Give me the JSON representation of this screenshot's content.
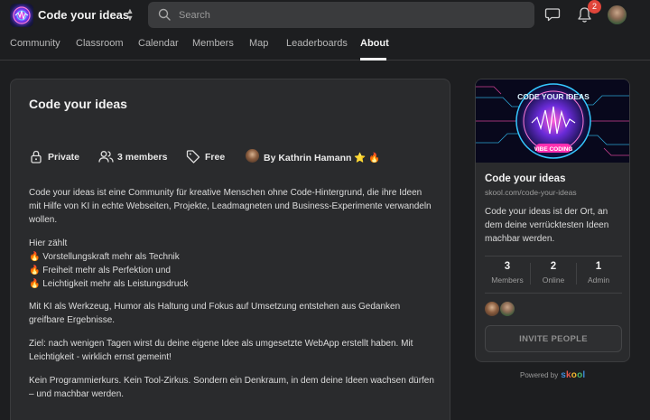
{
  "header": {
    "brand_name": "Code your ideas",
    "search_placeholder": "Search",
    "notification_count": "2"
  },
  "nav": {
    "tabs": [
      "Community",
      "Classroom",
      "Calendar",
      "Members",
      "Map",
      "Leaderboards",
      "About"
    ],
    "active_tab": "About"
  },
  "about": {
    "title": "Code your ideas",
    "meta": {
      "privacy": "Private",
      "members": "3 members",
      "price": "Free",
      "owner": "By Kathrin Hamann ⭐ 🔥"
    },
    "paragraphs": [
      "Code your ideas ist eine Community für kreative Menschen ohne Code-Hintergrund, die ihre Ideen mit Hilfe von KI in echte Webseiten, Projekte, Leadmagneten und Business-Experimente verwandeln wollen.",
      "Hier zählt",
      "🔥 Vorstellungskraft mehr als Technik",
      "🔥 Freiheit mehr als Perfektion und",
      "🔥 Leichtigkeit mehr als Leistungsdruck",
      "Mit KI als Werkzeug, Humor als Haltung und Fokus auf Umsetzung entstehen aus Gedanken greifbare Ergebnisse.",
      "Ziel: nach wenigen Tagen wirst du deine eigene Idee als umgesetzte WebApp erstellt haben. Mit Leichtigkeit - wirklich ernst gemeint!",
      "Kein Programmierkurs. Kein Tool-Zirkus. Sondern ein Denkraum, in dem deine Ideen wachsen dürfen – und machbar werden."
    ]
  },
  "sidebar": {
    "cover_text_top": "CODE YOUR IDEAS",
    "cover_text_bottom": "VIBE CODING",
    "name": "Code your ideas",
    "url": "skool.com/code-your-ideas",
    "description": "Code your ideas ist der Ort, an dem deine verrücktesten Ideen machbar werden.",
    "stats": [
      {
        "value": "3",
        "label": "Members"
      },
      {
        "value": "2",
        "label": "Online"
      },
      {
        "value": "1",
        "label": "Admin"
      }
    ],
    "invite_label": "INVITE PEOPLE"
  },
  "footer": {
    "powered_by": "Powered by",
    "skool_letters": [
      "s",
      "k",
      "o",
      "o",
      "l"
    ],
    "skool_colors": [
      "#3d8bd8",
      "#e6574c",
      "#f1b52f",
      "#49b76d",
      "#3d8bd8"
    ]
  },
  "colors": {
    "background": "#1d1e20",
    "card": "#2a2b2d",
    "badge": "#e0453a"
  }
}
